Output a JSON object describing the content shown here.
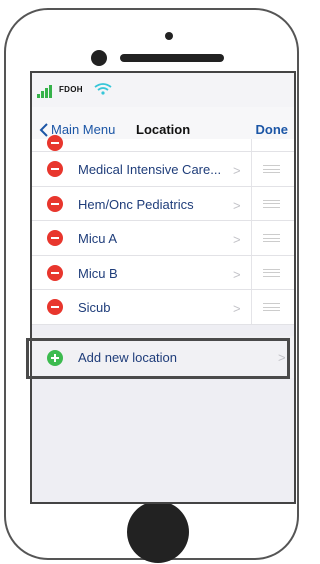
{
  "status_bar": {
    "carrier": "FDOH"
  },
  "nav": {
    "back_label": "Main Menu",
    "title": "Location",
    "done_label": "Done"
  },
  "locations": [
    {
      "label": "Medical Intensive Care..."
    },
    {
      "label": "Hem/Onc Pediatrics"
    },
    {
      "label": "Micu A"
    },
    {
      "label": "Micu B"
    },
    {
      "label": "Sicub"
    }
  ],
  "add_row": {
    "label": "Add new location"
  },
  "colors": {
    "accent_blue": "#1c56a6",
    "delete_red": "#e8362d",
    "add_green": "#3dbb4f",
    "signal_green": "#36b24a",
    "wifi_cyan": "#36c6d8"
  },
  "icons": {
    "delete": "minus-circle-icon",
    "add": "plus-circle-icon",
    "reorder": "reorder-grip-icon",
    "disclosure": "chevron-right-icon"
  }
}
